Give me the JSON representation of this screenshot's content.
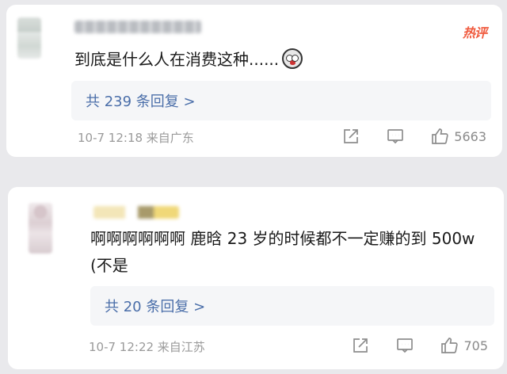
{
  "comments": [
    {
      "hot_badge": "热评",
      "text": "到底是什么人在消费这种......",
      "replies_label": "共 239 条回复 >",
      "meta": "10-7 12:18  来自广东",
      "like_count": "5663"
    },
    {
      "text": "啊啊啊啊啊啊 鹿晗 23 岁的时候都不一定赚的到 500w (不是",
      "replies_label": "共 20 条回复 >",
      "meta": "10-7 12:22  来自江苏",
      "like_count": "705"
    }
  ],
  "icons": {
    "share": "share-icon",
    "comment": "comment-icon",
    "like": "thumbs-up-icon",
    "emoji": "scared-face-emoji"
  },
  "colors": {
    "hot_badge": "#f05b3f",
    "reply_link": "#4a6ea9",
    "meta_text": "#9a9a9a",
    "background": "#e9e9ec"
  }
}
